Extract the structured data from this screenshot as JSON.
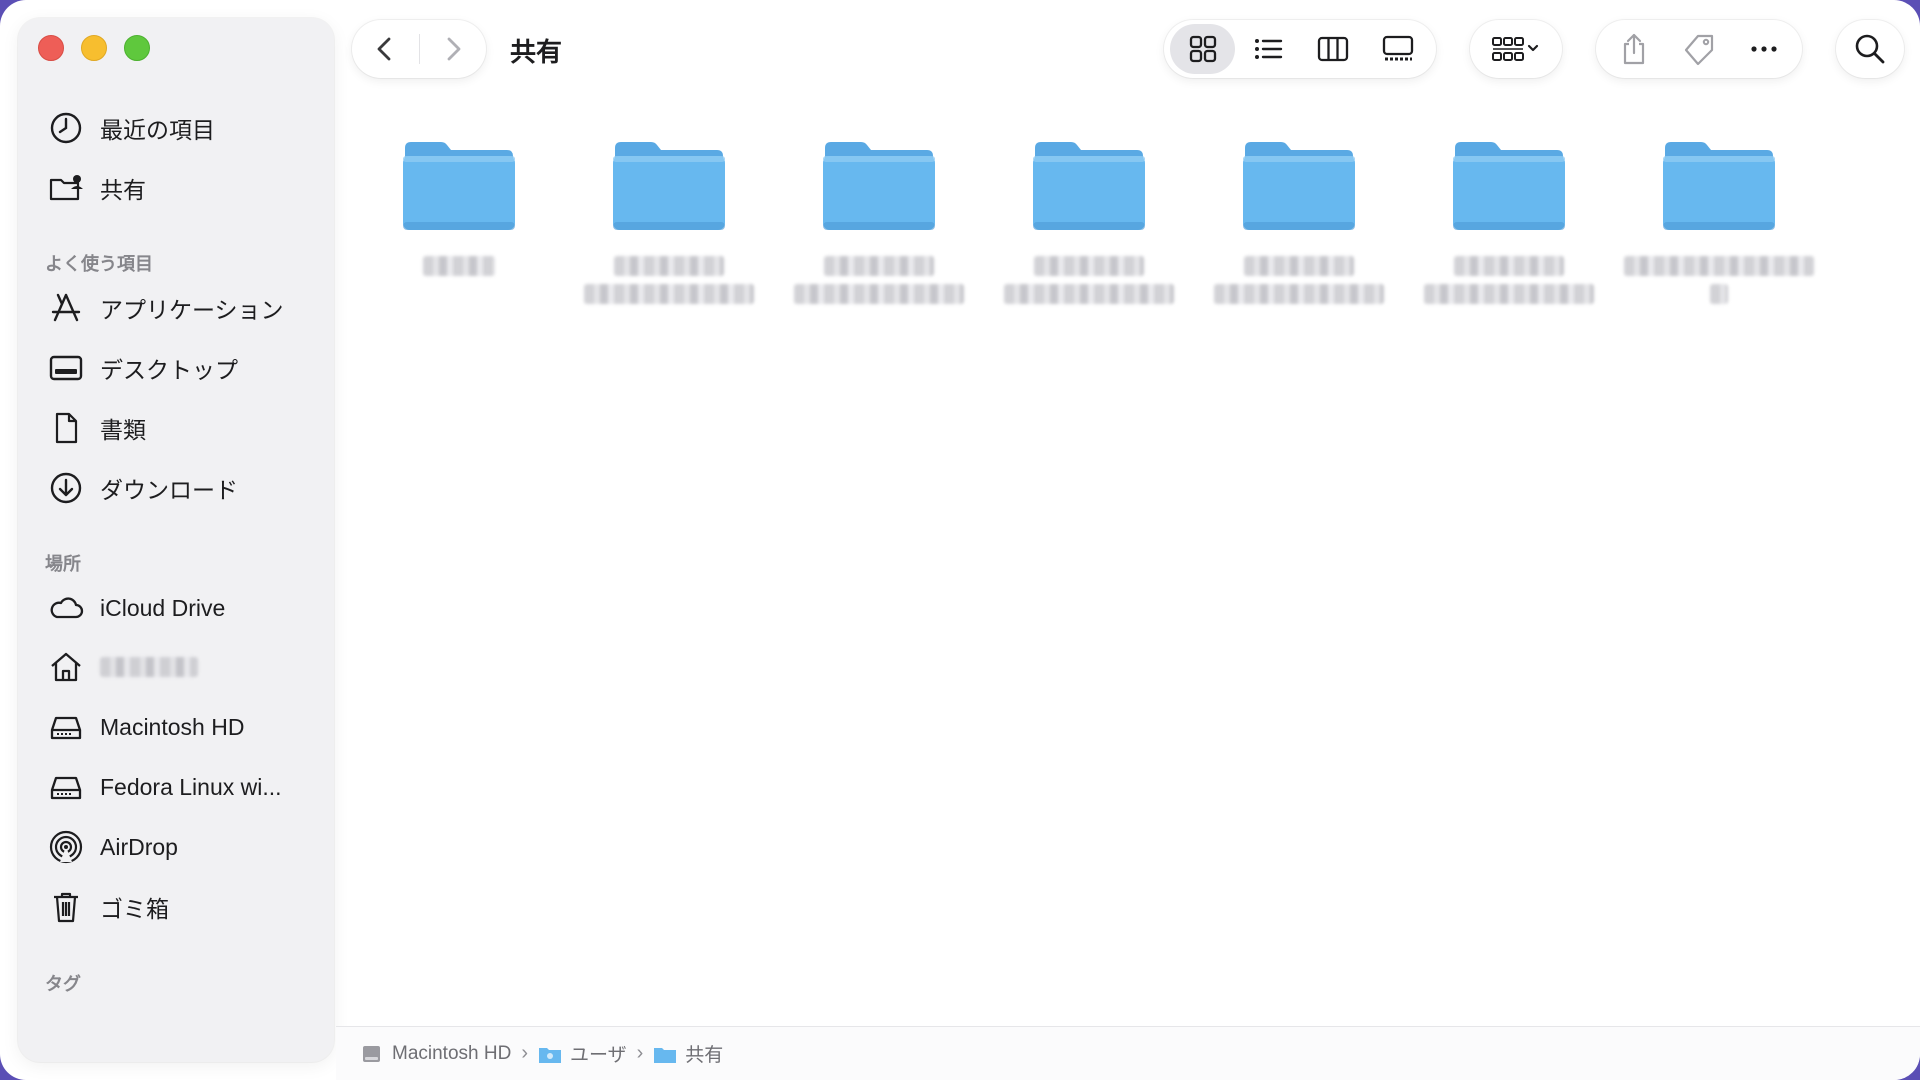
{
  "window": {
    "title": "共有"
  },
  "sidebar": {
    "top_items": [
      {
        "label": "最近の項目",
        "icon": "clock-icon"
      },
      {
        "label": "共有",
        "icon": "shared-folder-icon"
      }
    ],
    "favorites_header": "よく使う項目",
    "favorites": [
      {
        "label": "アプリケーション",
        "icon": "applications-icon"
      },
      {
        "label": "デスクトップ",
        "icon": "desktop-icon"
      },
      {
        "label": "書類",
        "icon": "document-icon"
      },
      {
        "label": "ダウンロード",
        "icon": "download-icon"
      }
    ],
    "locations_header": "場所",
    "locations": [
      {
        "label": "iCloud Drive",
        "icon": "cloud-icon"
      },
      {
        "label": "",
        "icon": "home-icon"
      },
      {
        "label": "Macintosh HD",
        "icon": "drive-icon"
      },
      {
        "label": "Fedora Linux wi...",
        "icon": "drive-icon"
      },
      {
        "label": "AirDrop",
        "icon": "airdrop-icon"
      },
      {
        "label": "ゴミ箱",
        "icon": "trash-icon"
      }
    ],
    "tags_header": "タグ"
  },
  "toolbar": {
    "back": "chevron-left-icon",
    "forward": "chevron-right-icon",
    "view_modes": [
      "icon-view-icon",
      "list-view-icon",
      "column-view-icon",
      "gallery-view-icon"
    ],
    "active_view": "icon-view-icon",
    "group": "group-icon",
    "share": "share-icon",
    "tag": "tag-icon",
    "more": "more-icon",
    "search": "search-icon"
  },
  "colors": {
    "folder": "#67b8ef",
    "accent": "#1a8cff"
  },
  "folders": [
    {
      "label": "",
      "lines": 1
    },
    {
      "label": "",
      "lines": 2
    },
    {
      "label": "",
      "lines": 2
    },
    {
      "label": "",
      "lines": 2
    },
    {
      "label": "",
      "lines": 2
    },
    {
      "label": "",
      "lines": 2
    },
    {
      "label": "",
      "lines": 2
    }
  ],
  "path_bar": [
    {
      "label": "Macintosh HD",
      "icon": "drive-icon"
    },
    {
      "label": "ユーザ",
      "icon": "folder-icon"
    },
    {
      "label": "共有",
      "icon": "folder-icon"
    }
  ]
}
